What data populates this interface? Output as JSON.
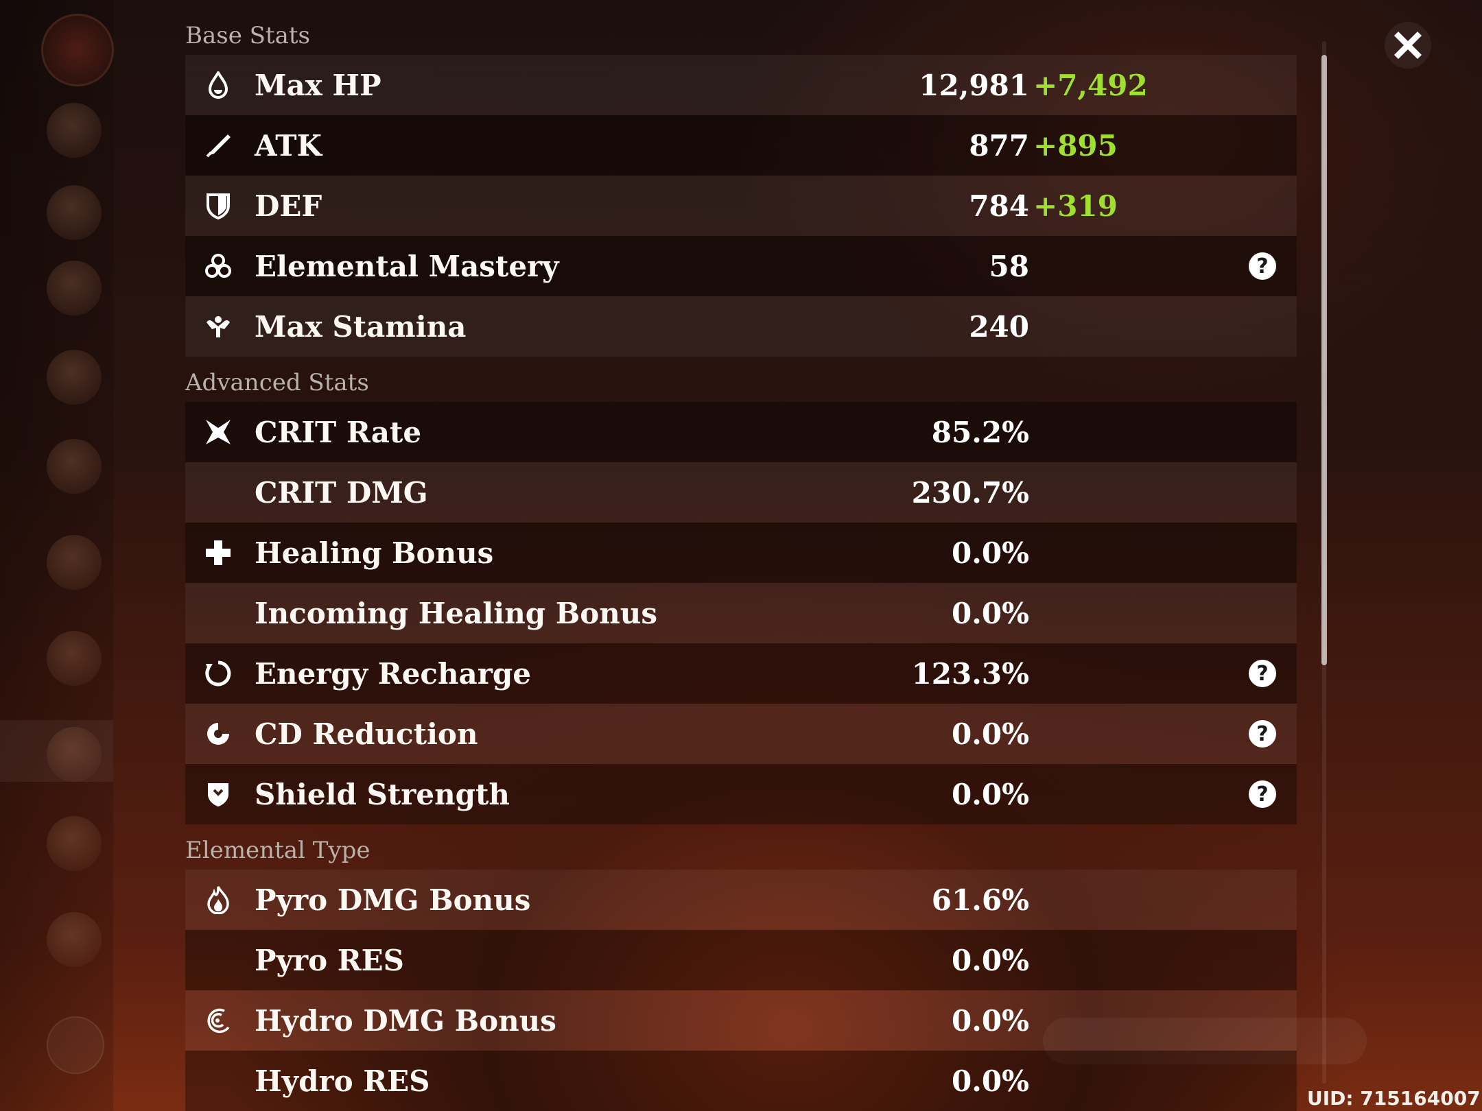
{
  "sections": {
    "base": "Base Stats",
    "advanced": "Advanced Stats",
    "elemental": "Elemental Type"
  },
  "base_stats": [
    {
      "label": "Max HP",
      "value": "12,981",
      "bonus": "+7,492",
      "icon": "hp-drop-icon"
    },
    {
      "label": "ATK",
      "value": "877",
      "bonus": "+895",
      "icon": "sword-icon"
    },
    {
      "label": "DEF",
      "value": "784",
      "bonus": "+319",
      "icon": "shield-icon"
    },
    {
      "label": "Elemental Mastery",
      "value": "58",
      "help": "?",
      "icon": "mastery-icon"
    },
    {
      "label": "Max Stamina",
      "value": "240",
      "icon": "stamina-icon"
    }
  ],
  "advanced_stats": [
    {
      "label": "CRIT Rate",
      "value": "85.2%",
      "icon": "crit-icon"
    },
    {
      "label": "CRIT DMG",
      "value": "230.7%"
    },
    {
      "label": "Healing Bonus",
      "value": "0.0%",
      "icon": "healing-cross-icon"
    },
    {
      "label": "Incoming Healing Bonus",
      "value": "0.0%"
    },
    {
      "label": "Energy Recharge",
      "value": "123.3%",
      "help": "?",
      "icon": "energy-recharge-icon"
    },
    {
      "label": "CD Reduction",
      "value": "0.0%",
      "help": "?",
      "icon": "cd-reduction-icon"
    },
    {
      "label": "Shield Strength",
      "value": "0.0%",
      "help": "?",
      "icon": "shield-strength-icon"
    }
  ],
  "elemental_stats": [
    {
      "label": "Pyro DMG Bonus",
      "value": "61.6%",
      "icon": "pyro-icon"
    },
    {
      "label": "Pyro RES",
      "value": "0.0%"
    },
    {
      "label": "Hydro DMG Bonus",
      "value": "0.0%",
      "icon": "hydro-icon"
    },
    {
      "label": "Hydro RES",
      "value": "0.0%"
    }
  ],
  "uid": "UID: 715164007",
  "colors": {
    "bonus": "#9edf2f",
    "section_title": "#b9b2ab"
  }
}
